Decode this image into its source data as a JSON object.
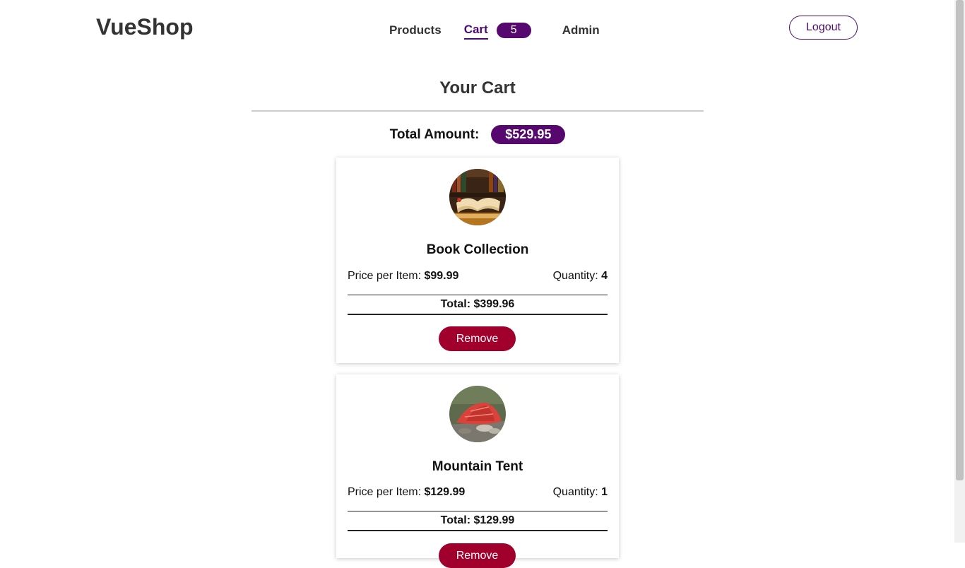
{
  "header": {
    "logo": "VueShop",
    "nav": {
      "products": "Products",
      "cart": "Cart",
      "cart_count": "5",
      "admin": "Admin"
    },
    "logout": "Logout"
  },
  "cart": {
    "title": "Your Cart",
    "total_label": "Total Amount:",
    "total_value": "$529.95",
    "items": [
      {
        "name": "Book Collection",
        "price_label": "Price per Item:",
        "price": "$99.99",
        "qty_label": "Quantity:",
        "qty": "4",
        "total": "Total: $399.96",
        "remove": "Remove",
        "image": "book-photo"
      },
      {
        "name": "Mountain Tent",
        "price_label": "Price per Item:",
        "price": "$129.99",
        "qty_label": "Quantity:",
        "qty": "1",
        "total": "Total: $129.99",
        "remove": "Remove",
        "image": "tent-photo"
      }
    ]
  },
  "colors": {
    "accent": "#56086f",
    "danger": "#a0002b"
  }
}
